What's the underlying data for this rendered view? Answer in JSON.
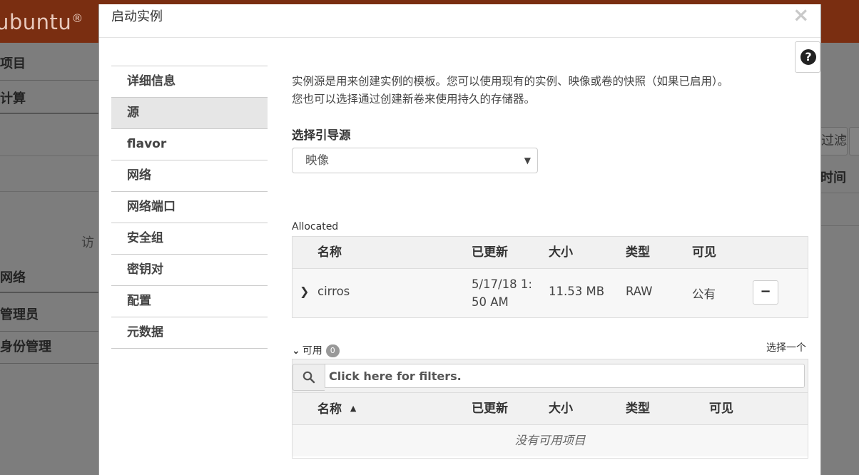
{
  "background": {
    "logo_text": "ubuntu",
    "logo_mark": "®",
    "nav": [
      "项目",
      "计算",
      "网络",
      "管理员",
      "身份管理"
    ],
    "filter_button": "过滤",
    "column_header": "时间",
    "visit_text": "访"
  },
  "modal": {
    "title": "启动实例",
    "close_symbol": "×",
    "help_symbol": "?",
    "steps": [
      {
        "label": "详细信息",
        "active": false
      },
      {
        "label": "源",
        "active": true
      },
      {
        "label": "flavor",
        "active": false
      },
      {
        "label": "网络",
        "active": false
      },
      {
        "label": "网络端口",
        "active": false
      },
      {
        "label": "安全组",
        "active": false
      },
      {
        "label": "密钥对",
        "active": false
      },
      {
        "label": "配置",
        "active": false
      },
      {
        "label": "元数据",
        "active": false
      }
    ],
    "description": [
      "实例源是用来创建实例的模板。您可以使用现有的实例、映像或卷的快照（如果已启用）。",
      "您也可以选择通过创建新卷来使用持久的存储器。"
    ],
    "boot_source": {
      "label": "选择引导源",
      "value": "映像"
    },
    "allocated": {
      "label": "Allocated",
      "columns": [
        "名称",
        "已更新",
        "大小",
        "类型",
        "可见"
      ],
      "rows": [
        {
          "name": "cirros",
          "updated_line1": "5/17/18 1:",
          "updated_line2": "50 AM",
          "size": "11.53 MB",
          "type": "RAW",
          "visibility": "公有",
          "remove": "−"
        }
      ]
    },
    "available": {
      "label": "可用",
      "count": "0",
      "select_one": "选择一个",
      "filter_placeholder": "Click here for filters.",
      "columns": [
        "名称",
        "已更新",
        "大小",
        "类型",
        "可见"
      ],
      "sort_indicator": "▲",
      "empty_text": "没有可用项目"
    }
  }
}
